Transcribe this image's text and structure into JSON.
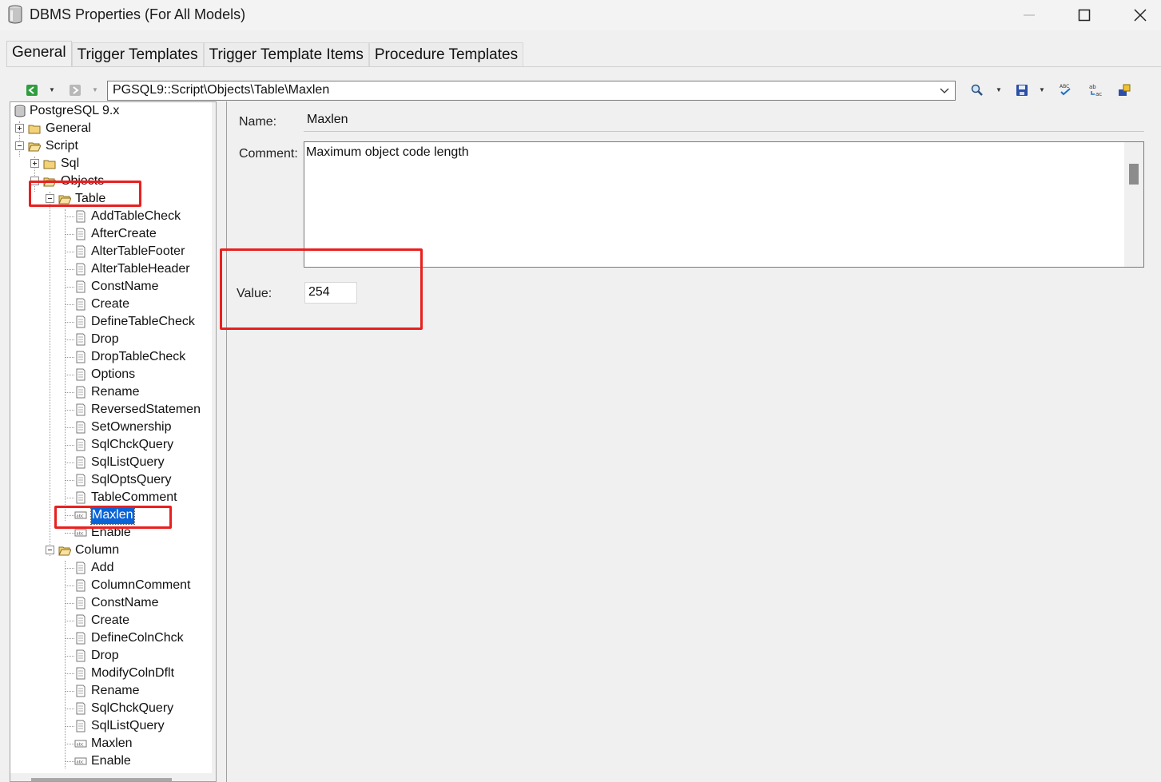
{
  "window": {
    "title": "DBMS Properties (For All Models)"
  },
  "tabs": [
    "General",
    "Trigger Templates",
    "Trigger Template Items",
    "Procedure Templates"
  ],
  "toolbar": {
    "path": "PGSQL9::Script\\Objects\\Table\\Maxlen"
  },
  "tree": {
    "root": "PostgreSQL 9.x",
    "general": "General",
    "script": "Script",
    "sql": "Sql",
    "objects": "Objects",
    "table": "Table",
    "table_items": [
      "AddTableCheck",
      "AfterCreate",
      "AlterTableFooter",
      "AlterTableHeader",
      "ConstName",
      "Create",
      "DefineTableCheck",
      "Drop",
      "DropTableCheck",
      "Options",
      "Rename",
      "ReversedStatemen",
      "SetOwnership",
      "SqlChckQuery",
      "SqlListQuery",
      "SqlOptsQuery",
      "TableComment",
      "Maxlen",
      "Enable"
    ],
    "column": "Column",
    "column_items": [
      "Add",
      "ColumnComment",
      "ConstName",
      "Create",
      "DefineColnChck",
      "Drop",
      "ModifyColnDflt",
      "Rename",
      "SqlChckQuery",
      "SqlListQuery",
      "Maxlen",
      "Enable"
    ]
  },
  "details": {
    "name_label": "Name:",
    "name_value": "Maxlen",
    "comment_label": "Comment:",
    "comment_value": "Maximum object code length",
    "value_label": "Value:",
    "value_value": "254"
  },
  "colors": {
    "highlight": "#e8201f",
    "selection": "#0a64d6"
  }
}
